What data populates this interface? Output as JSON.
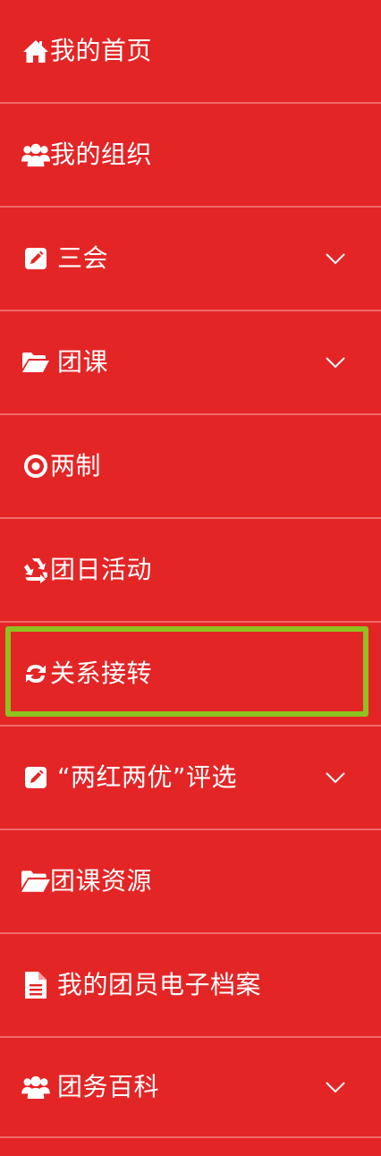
{
  "menu": {
    "items": [
      {
        "label": "我的首页",
        "icon": "home-icon",
        "expandable": false
      },
      {
        "label": "我的组织",
        "icon": "users-icon",
        "expandable": false
      },
      {
        "label": "三会",
        "icon": "edit-square-icon",
        "expandable": true
      },
      {
        "label": "团课",
        "icon": "folder-open-icon",
        "expandable": true
      },
      {
        "label": "两制",
        "icon": "target-icon",
        "expandable": false
      },
      {
        "label": "团日活动",
        "icon": "recycle-icon",
        "expandable": false
      },
      {
        "label": "关系接转",
        "icon": "refresh-icon",
        "expandable": false,
        "highlighted": true
      },
      {
        "label": "“两红两优”评选",
        "icon": "edit-square-icon",
        "expandable": true
      },
      {
        "label": "团课资源",
        "icon": "folder-open-icon",
        "expandable": false
      },
      {
        "label": "我的团员电子档案",
        "icon": "file-text-icon",
        "expandable": false
      },
      {
        "label": "团务百科",
        "icon": "users-icon",
        "expandable": true
      }
    ]
  },
  "colors": {
    "background": "#e42526",
    "divider": "#f06a6a",
    "text": "#ffffff",
    "highlight_border": "#8dc21f"
  }
}
